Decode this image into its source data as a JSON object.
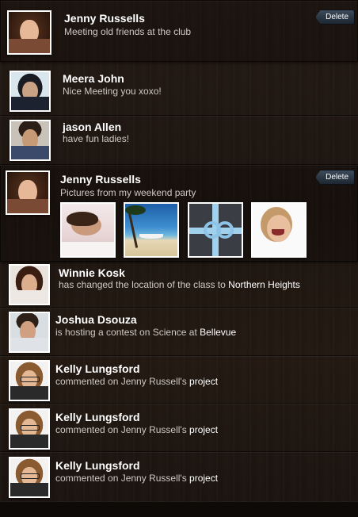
{
  "feed": {
    "items": [
      {
        "name": "Jenny Russells",
        "message": "Meeting old friends at the club",
        "action": "Delete"
      },
      {
        "name": "Meera John",
        "message": "Nice Meeting you xoxo!"
      },
      {
        "name": "jason Allen",
        "message": "have fun ladies!"
      },
      {
        "name": "Jenny Russells",
        "message": "Pictures from my weekend party",
        "action": "Delete",
        "photos": [
          "woman-relaxing-photo",
          "beach-hammock-photo",
          "gift-box-ribbon-photo",
          "laughing-woman-photo"
        ]
      },
      {
        "name": "Winnie Kosk",
        "message_prefix": "has changed the location of the class to ",
        "message_highlight": "Northern Heights"
      },
      {
        "name": "Joshua Dsouza",
        "message_prefix": "is hosting a contest on Science at ",
        "message_highlight": "Bellevue"
      },
      {
        "name": "Kelly Lungsford",
        "message_prefix": "commented on Jenny Russell's ",
        "message_highlight": "project"
      },
      {
        "name": "Kelly Lungsford",
        "message_prefix": "commented on Jenny Russell's ",
        "message_highlight": "project"
      },
      {
        "name": "Kelly Lungsford",
        "message_prefix": "commented on Jenny Russell's ",
        "message_highlight": "project"
      }
    ]
  },
  "colors": {
    "background": "#1f1712",
    "name_text": "#ffffff",
    "message_text": "#cfc8c2",
    "delete_button": "#2a3643"
  }
}
